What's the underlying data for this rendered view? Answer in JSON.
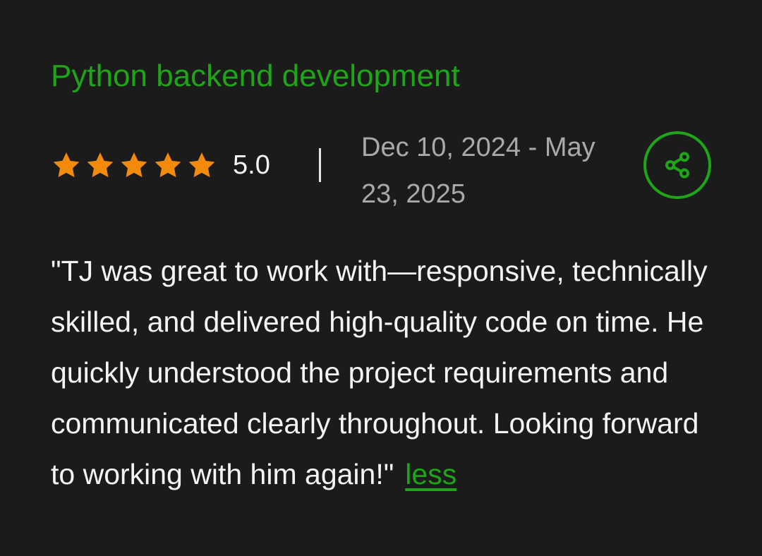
{
  "review": {
    "job_title": "Python backend development",
    "rating": {
      "value": 5,
      "max": 5,
      "label": "5.0",
      "star_color": "#f28a0c"
    },
    "date_range": "Dec 10, 2024 - May 23, 2025",
    "share_icon": "share-icon",
    "text": "\"TJ was great to work with—responsive, technically skilled, and delivered high-quality code on time. He quickly understood the project requirements and communicated clearly throughout. Looking forward to working with him again!\"",
    "toggle_label": "less"
  },
  "colors": {
    "background": "#1b1b1b",
    "accent": "#1fa518",
    "text_primary": "#f4f4f4",
    "text_secondary": "#a9a9a9"
  }
}
